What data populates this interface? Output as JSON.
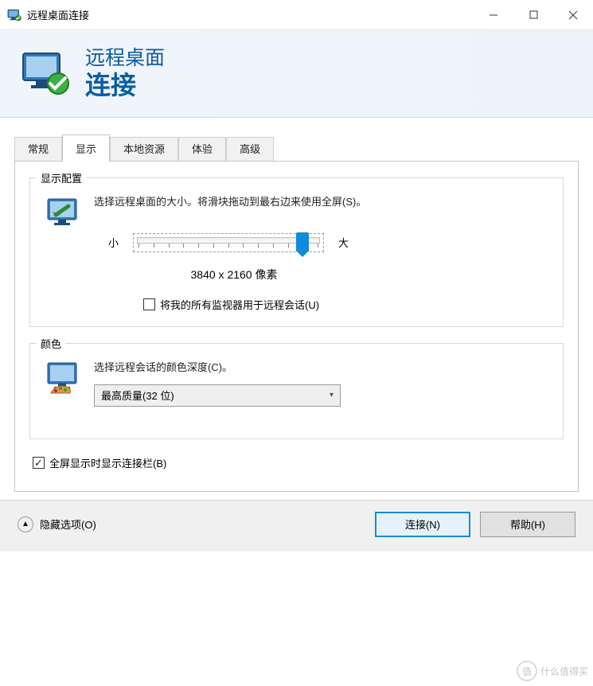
{
  "titlebar": {
    "title": "远程桌面连接"
  },
  "header": {
    "line1": "远程桌面",
    "line2": "连接"
  },
  "tabs": [
    "常规",
    "显示",
    "本地资源",
    "体验",
    "高级"
  ],
  "active_tab_index": 1,
  "display_config": {
    "group_title": "显示配置",
    "instruction": "选择远程桌面的大小。将滑块拖动到最右边来使用全屏(S)。",
    "slider_min_label": "小",
    "slider_max_label": "大",
    "resolution_text": "3840 x 2160 像素",
    "all_monitors_label": "将我的所有监视器用于远程会话(U)"
  },
  "color": {
    "group_title": "颜色",
    "instruction": "选择远程会话的颜色深度(C)。",
    "combo_value": "最高质量(32 位)"
  },
  "fullscreen_bar_label": "全屏显示时显示连接栏(B)",
  "bottom": {
    "options_label": "隐藏选项(O)",
    "connect": "连接(N)",
    "help": "帮助(H)"
  },
  "watermark": "什么值得买"
}
